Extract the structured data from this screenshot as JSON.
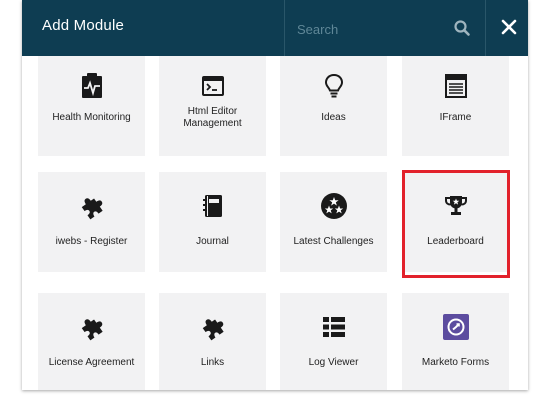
{
  "dialog": {
    "title": "Add Module",
    "search_placeholder": "Search",
    "close_label": "✕"
  },
  "modules": [
    {
      "label": "Health Monitoring",
      "icon": "health-monitor-icon"
    },
    {
      "label": "Html Editor Management",
      "icon": "terminal-window-icon"
    },
    {
      "label": "Ideas",
      "icon": "lightbulb-icon"
    },
    {
      "label": "IFrame",
      "icon": "iframe-icon"
    },
    {
      "label": "iwebs - Register",
      "icon": "puzzle-piece-icon"
    },
    {
      "label": "Journal",
      "icon": "journal-icon"
    },
    {
      "label": "Latest Challenges",
      "icon": "stars-circle-icon"
    },
    {
      "label": "Leaderboard",
      "icon": "trophy-icon"
    },
    {
      "label": "License Agreement",
      "icon": "puzzle-piece-icon"
    },
    {
      "label": "Links",
      "icon": "puzzle-piece-icon"
    },
    {
      "label": "Log Viewer",
      "icon": "list-icon"
    },
    {
      "label": "Marketo Forms",
      "icon": "marketo-icon"
    }
  ],
  "colors": {
    "header": "#0e3d52",
    "tile": "#f2f2f3",
    "highlight": "#e2212b",
    "marketo": "#5c4c9f"
  }
}
